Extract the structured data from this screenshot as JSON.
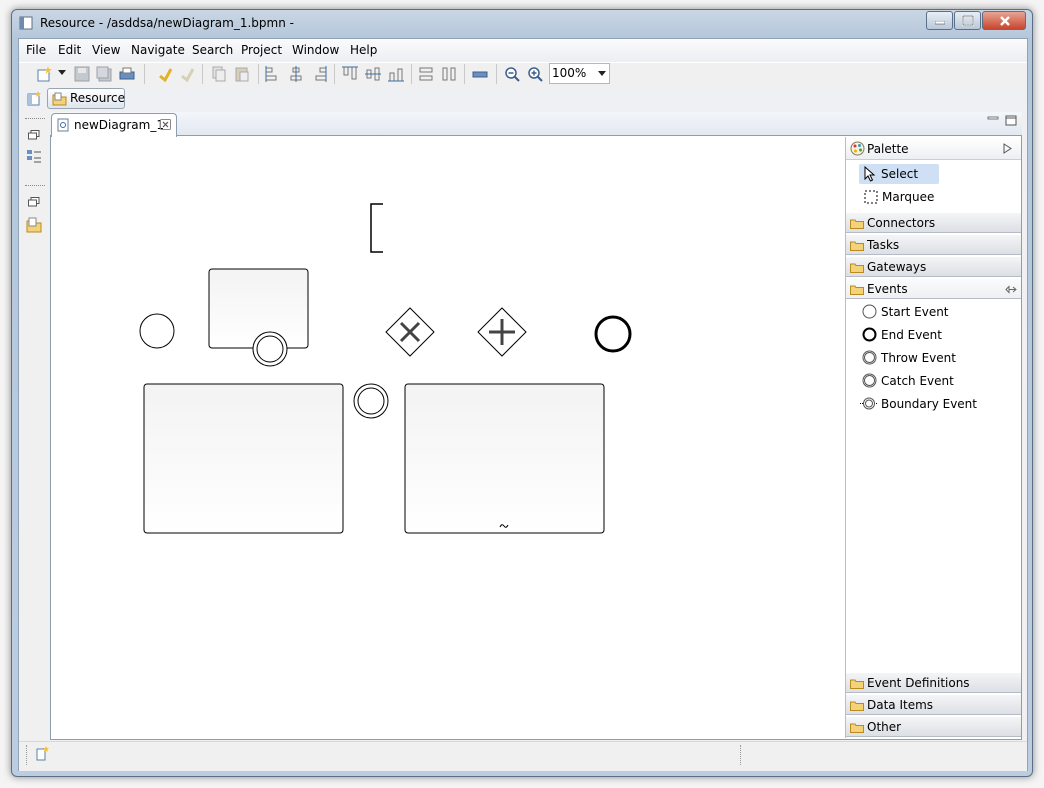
{
  "window": {
    "title": "Resource - /asddsa/newDiagram_1.bpmn -",
    "controls": [
      "minimize",
      "maximize",
      "close"
    ]
  },
  "menubar": {
    "items": [
      "File",
      "Edit",
      "View",
      "Navigate",
      "Search",
      "Project",
      "Window",
      "Help"
    ]
  },
  "toolbar": {
    "zoom_value": "100%"
  },
  "perspective": {
    "label": "Resource"
  },
  "editor": {
    "tab_title": "newDiagram_1"
  },
  "palette": {
    "title": "Palette",
    "tools": [
      "Select",
      "Marquee"
    ],
    "drawers_top": [
      "Connectors",
      "Tasks",
      "Gateways",
      "Events"
    ],
    "events": [
      "Start Event",
      "End Event",
      "Throw Event",
      "Catch Event",
      "Boundary Event"
    ],
    "drawers_bottom": [
      "Event Definitions",
      "Data Items",
      "Other"
    ]
  },
  "colors": {
    "selection": "#cfe0f5",
    "frame": "#b9cbde"
  },
  "icons": {
    "new": "new-wizard-icon",
    "save": "save-icon",
    "undo": "undo-icon",
    "zoom_out": "zoom-out-icon",
    "zoom_in": "zoom-in-icon"
  }
}
